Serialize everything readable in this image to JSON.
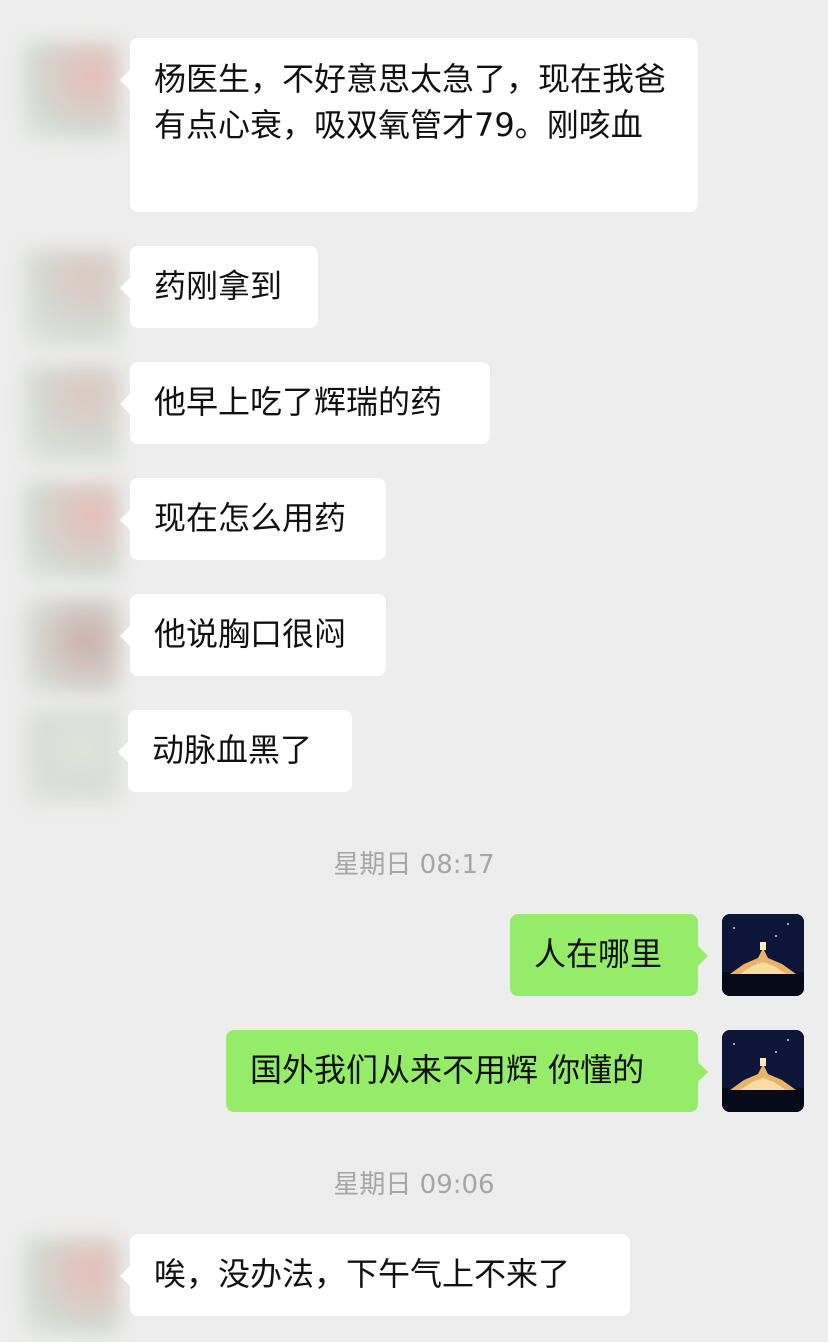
{
  "messages": [
    {
      "side": "in",
      "text": "杨医生，不好意思太急了，现在我爸有点心衰，吸双氧管才79。刚咳血"
    },
    {
      "side": "in",
      "text": "药刚拿到"
    },
    {
      "side": "in",
      "text": "他早上吃了辉瑞的药"
    },
    {
      "side": "in",
      "text": "现在怎么用药"
    },
    {
      "side": "in",
      "text": "他说胸口很闷"
    },
    {
      "side": "in",
      "text": "动脉血黑了"
    },
    {
      "side": "out",
      "text": "人在哪里"
    },
    {
      "side": "out",
      "text": "国外我们从来不用辉 你懂的"
    },
    {
      "side": "in",
      "text": "唉，没办法，下午气上不来了"
    }
  ],
  "timestamps": [
    "星期日 08:17",
    "星期日 09:06"
  ],
  "colors": {
    "background": "#ededed",
    "incoming_bubble": "#ffffff",
    "outgoing_bubble": "#95ec69",
    "timestamp_text": "#a6a6a6"
  },
  "icons": {
    "contact_avatar": "blurred-avatar",
    "self_avatar": "night-temple-photo-avatar"
  }
}
